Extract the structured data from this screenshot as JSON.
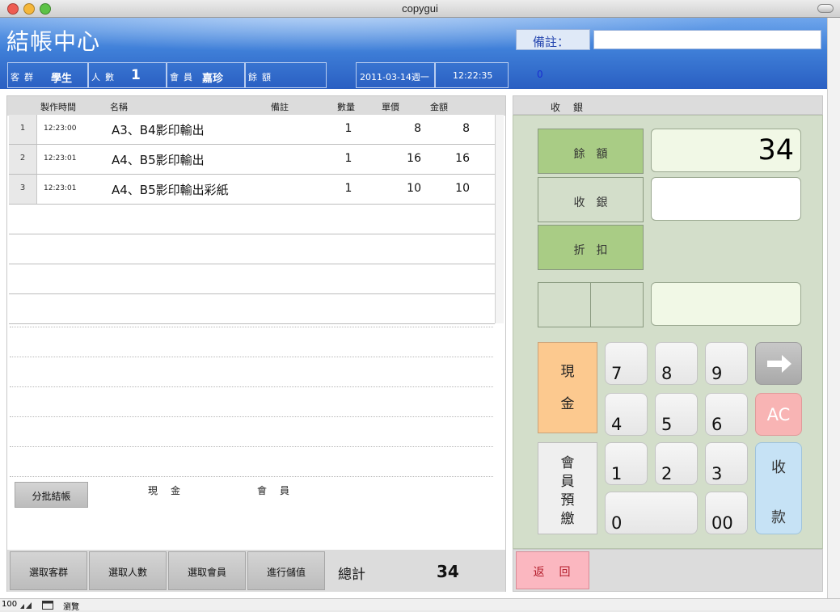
{
  "window": {
    "title": "copygui"
  },
  "header": {
    "title": "結帳中心",
    "remark_label": "備註：",
    "remark_value": "",
    "customer_group_label": "客群",
    "customer_group_value": "學生",
    "people_label": "人數",
    "people_value": "1",
    "member_label": "會員",
    "member_value": "嘉珍",
    "balance_label": "餘額",
    "balance_value": "",
    "date": "2011-03-14週一",
    "time": "12:22:35",
    "right_value": "0"
  },
  "table": {
    "columns": [
      "製作時間",
      "名稱",
      "備註",
      "數量",
      "單價",
      "金額"
    ],
    "rows": [
      {
        "index": "1",
        "time": "12:23:00",
        "name": "A3、B4影印輸出",
        "note": "",
        "qty": "1",
        "price": "8",
        "amount": "8"
      },
      {
        "index": "2",
        "time": "12:23:01",
        "name": "A4、B5影印輸出",
        "note": "",
        "qty": "1",
        "price": "16",
        "amount": "16"
      },
      {
        "index": "3",
        "time": "12:23:01",
        "name": "A4、B5影印輸出彩紙",
        "note": "",
        "qty": "1",
        "price": "10",
        "amount": "10"
      }
    ]
  },
  "split": {
    "button": "分批結帳",
    "cash_label": "現　金",
    "member_label": "會　員"
  },
  "bottom": {
    "select_group": "選取客群",
    "select_people": "選取人數",
    "select_member": "選取會員",
    "deposit": "進行儲值",
    "total_label": "總計",
    "total_value": "34"
  },
  "cashier": {
    "tab_label": "收　銀",
    "balance_label": "餘額",
    "balance_value": "34",
    "receive_label": "收銀",
    "receive_value": "",
    "discount_label": "折扣",
    "cash_button": "現金",
    "member_prepaid_button": "會員預繳",
    "keys": [
      "7",
      "8",
      "9",
      "4",
      "5",
      "6",
      "1",
      "2",
      "3",
      "0",
      "00"
    ],
    "ac_button": "AC",
    "collect_button": "收款",
    "back_button": "返　回"
  },
  "statusbar": {
    "zoom": "100",
    "mode": "瀏覽"
  },
  "colors": {
    "header_blue": "#3f7fd8",
    "panel_green": "#d3deca",
    "cash_orange": "#fcc98f",
    "ac_red": "#f8b4b4",
    "collect_blue": "#c6e2f5",
    "back_red": "#fbb7c0",
    "green_box": "#a9cc85"
  }
}
